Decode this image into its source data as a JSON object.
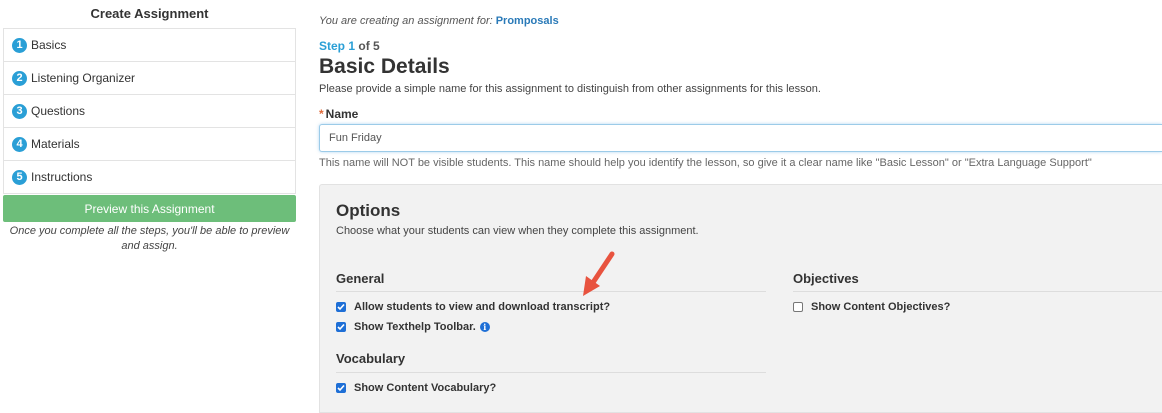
{
  "sidebar": {
    "title": "Create Assignment",
    "steps": [
      {
        "num": "1",
        "label": "Basics"
      },
      {
        "num": "2",
        "label": "Listening Organizer"
      },
      {
        "num": "3",
        "label": "Questions"
      },
      {
        "num": "4",
        "label": "Materials"
      },
      {
        "num": "5",
        "label": "Instructions"
      }
    ],
    "preview_label": "Preview this Assignment",
    "preview_note": "Once you complete all the steps, you'll be able to preview and assign."
  },
  "header": {
    "creating_prefix": "You are creating an assignment for: ",
    "lesson_link": "Promposals",
    "step_word": "Step",
    "step_current": "1",
    "step_of": "of 5",
    "title": "Basic Details",
    "description": "Please provide a simple name for this assignment to distinguish from other assignments for this lesson."
  },
  "name_field": {
    "required_mark": "*",
    "label": "Name",
    "value": "Fun Friday",
    "help": "This name will NOT be visible students. This name should help you identify the lesson, so give it a clear name like \"Basic Lesson\" or \"Extra Language Support\""
  },
  "options": {
    "title": "Options",
    "description": "Choose what your students can view when they complete this assignment.",
    "general": {
      "heading": "General",
      "items": [
        {
          "label": "Allow students to view and download transcript?",
          "checked": true
        },
        {
          "label": "Show Texthelp Toolbar.",
          "checked": true
        }
      ]
    },
    "objectives": {
      "heading": "Objectives",
      "items": [
        {
          "label": "Show Content Objectives?",
          "checked": false
        }
      ]
    },
    "vocabulary": {
      "heading": "Vocabulary",
      "items": [
        {
          "label": "Show Content Vocabulary?",
          "checked": true
        }
      ]
    },
    "info_icon": "info-icon"
  },
  "colors": {
    "accent_blue": "#2a9fd6",
    "preview_green": "#6dbe7a",
    "checkbox_blue": "#1e6fd6",
    "annotation_arrow": "#e8533f"
  }
}
